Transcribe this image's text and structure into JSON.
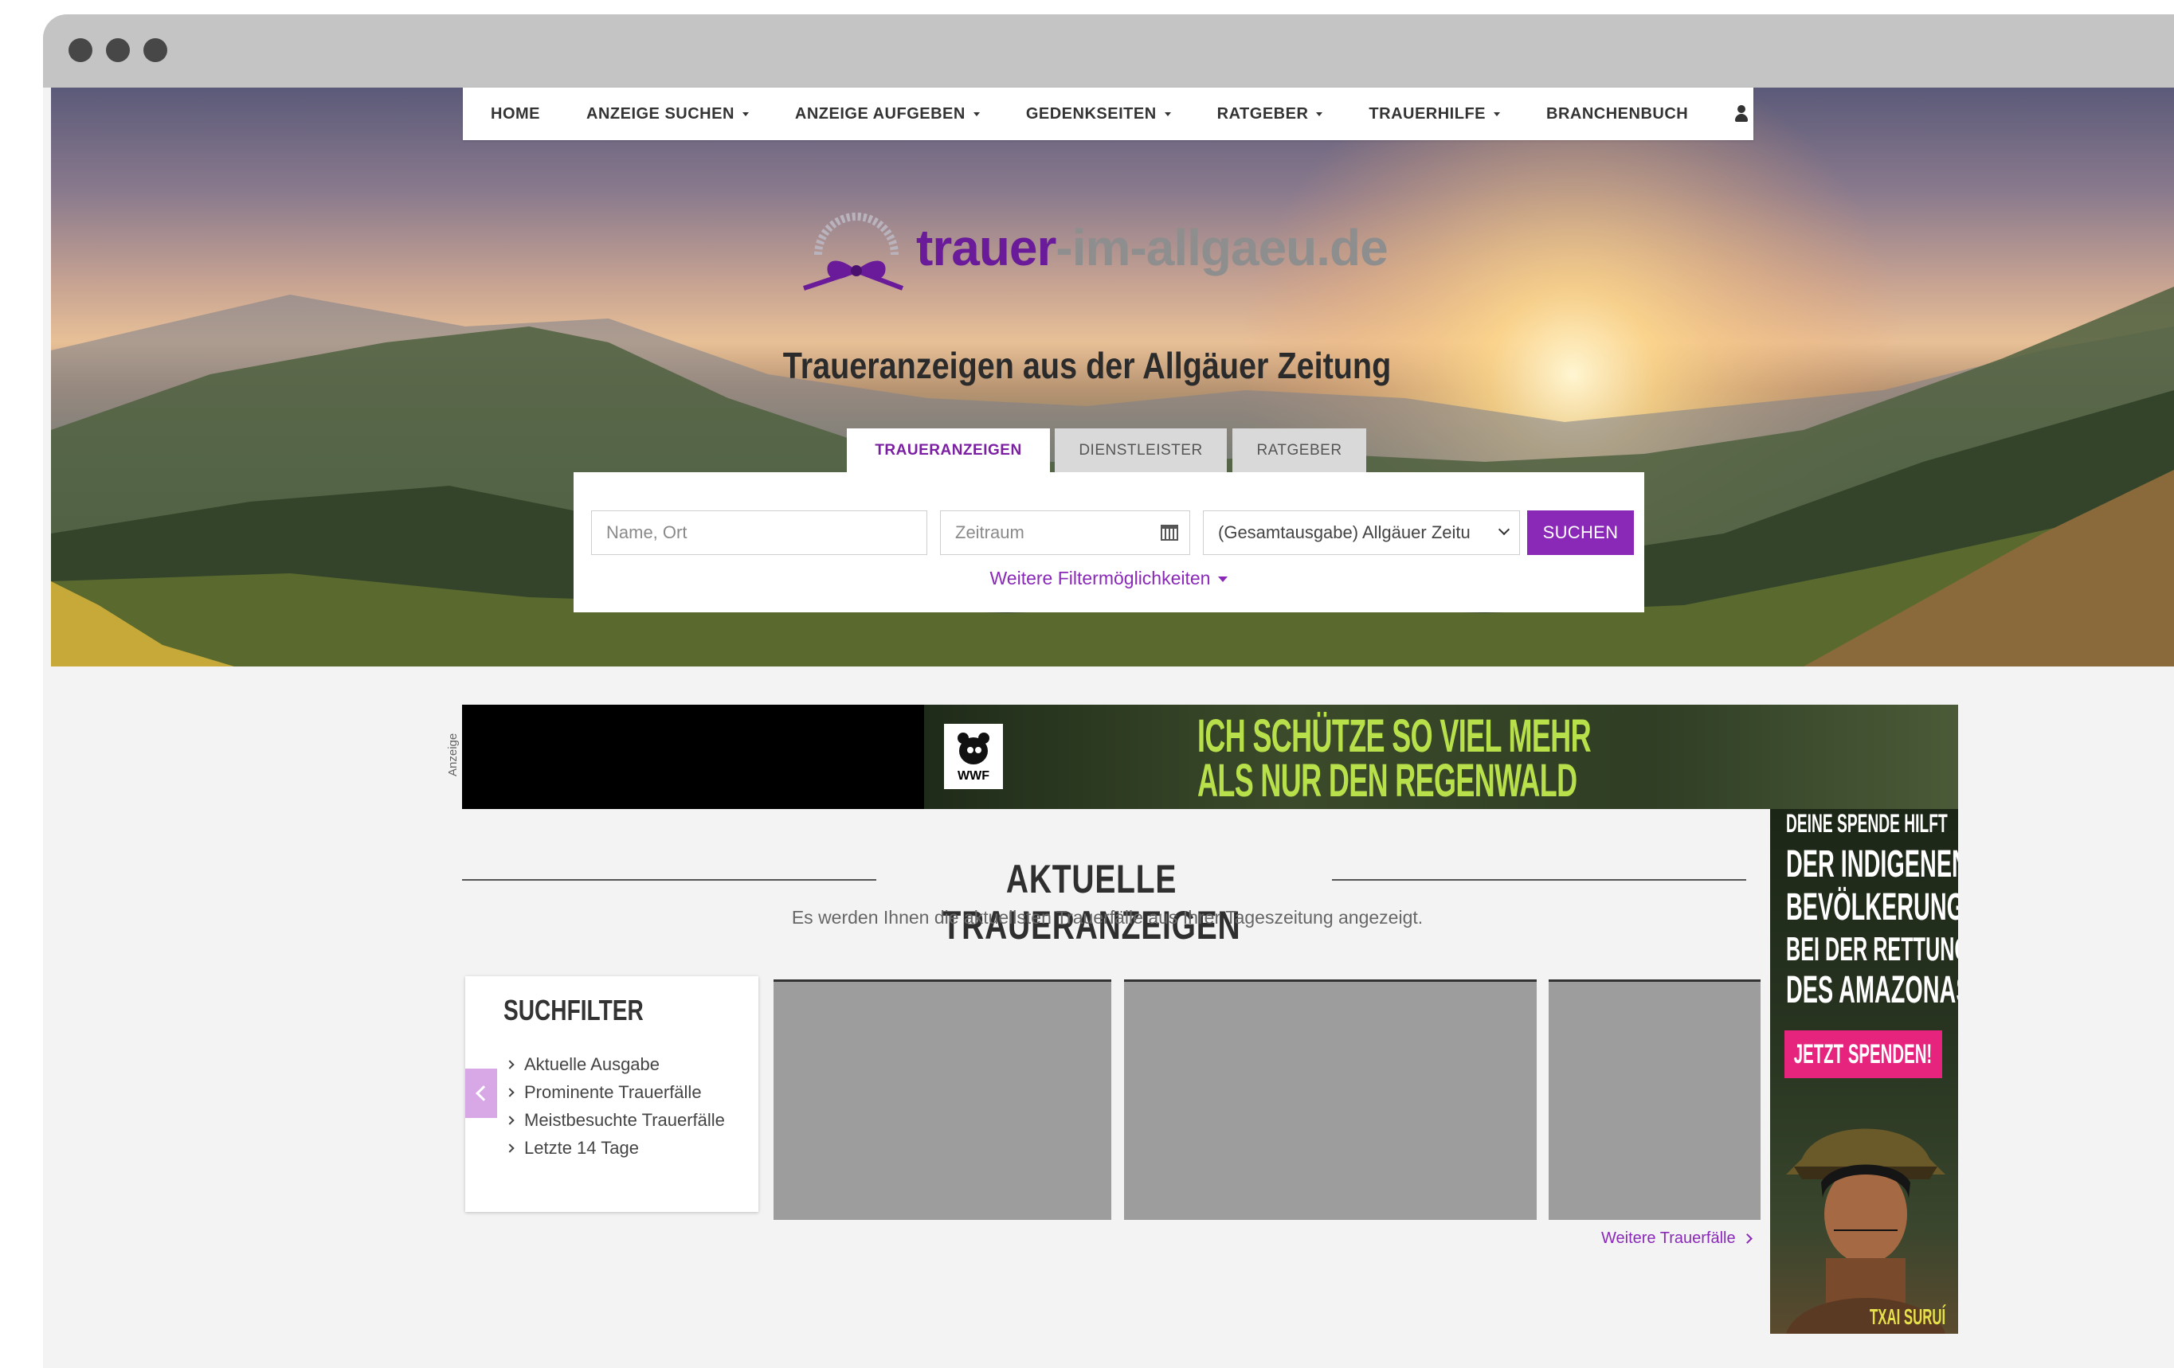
{
  "nav": {
    "items": [
      {
        "label": "HOME",
        "dropdown": false
      },
      {
        "label": "ANZEIGE SUCHEN",
        "dropdown": true
      },
      {
        "label": "ANZEIGE AUFGEBEN",
        "dropdown": true
      },
      {
        "label": "GEDENKSEITEN",
        "dropdown": true
      },
      {
        "label": "RATGEBER",
        "dropdown": true
      },
      {
        "label": "TRAUERHILFE",
        "dropdown": true
      },
      {
        "label": "BRANCHENBUCH",
        "dropdown": false
      }
    ],
    "user_icon": "user-icon"
  },
  "logo": {
    "part1": "trauer",
    "part2": "-im-allgaeu.de"
  },
  "hero": {
    "title": "Traueranzeigen aus der Allgäuer Zeitung"
  },
  "tabs": [
    {
      "label": "TRAUERANZEIGEN",
      "active": true
    },
    {
      "label": "DIENSTLEISTER",
      "active": false
    },
    {
      "label": "RATGEBER",
      "active": false
    }
  ],
  "search": {
    "name_placeholder": "Name, Ort",
    "date_placeholder": "Zeitraum",
    "edition_selected": "(Gesamtausgabe) Allgäuer Zeitu",
    "submit_label": "SUCHEN",
    "more_filters": "Weitere Filtermöglichkeiten"
  },
  "ad_top": {
    "label": "Anzeige",
    "logo_text": "WWF",
    "line1": "ICH SCHÜTZE SO VIEL MEHR",
    "line2": "ALS NUR DEN REGENWALD"
  },
  "ad_right": {
    "line1": "DEINE SPENDE HILFT",
    "line2": "DER INDIGENEN",
    "line3": "BEVÖLKERUNG",
    "line4": "BEI DER RETTUNG",
    "line5": "DES AMAZONAS",
    "button": "JETZT SPENDEN!",
    "name": "TXAI SURUÍ"
  },
  "section": {
    "title": "AKTUELLE TRAUERANZEIGEN",
    "subtitle": "Es werden Ihnen die aktuellsten Trauerfälle aus Ihrer Tageszeitung angezeigt."
  },
  "filter": {
    "title": "SUCHFILTER",
    "items": [
      "Aktuelle Ausgabe",
      "Prominente Trauerfälle",
      "Meistbesuchte Trauerfälle",
      "Letzte 14 Tage"
    ]
  },
  "more_link": "Weitere Trauerfälle",
  "colors": {
    "accent": "#8a29b8",
    "logo_purple": "#6a1b9a",
    "ad_green": "#b8e04a",
    "donate_pink": "#e6247e"
  }
}
